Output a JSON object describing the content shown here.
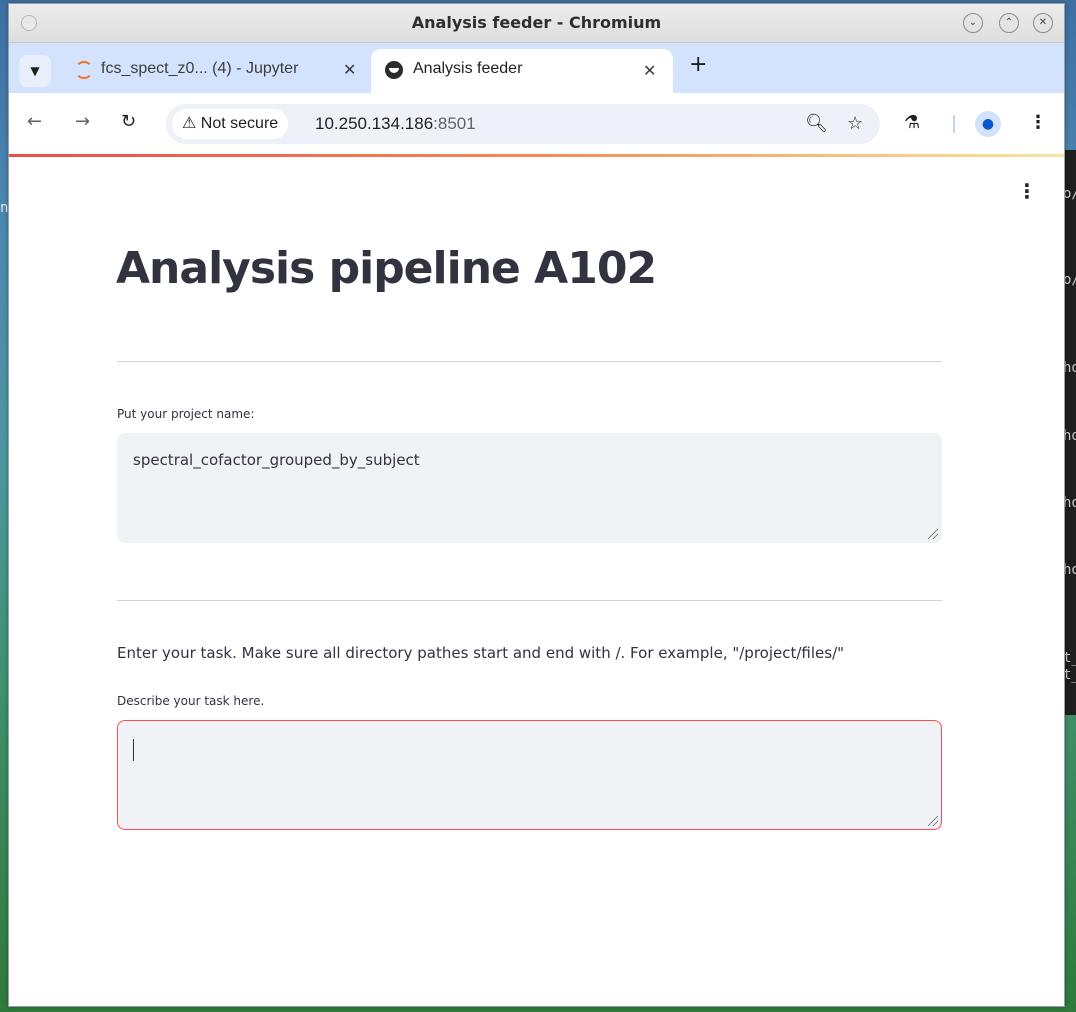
{
  "window": {
    "title": "Analysis feeder - Chromium"
  },
  "tabs": [
    {
      "label": "fcs_spect_z0... (4) - Jupyter",
      "active": false,
      "icon": "jupyter-icon"
    },
    {
      "label": "Analysis feeder",
      "active": true,
      "icon": "streamlit-icon"
    }
  ],
  "toolbar": {
    "security_chip": "Not secure",
    "url_host": "10.250.134.186",
    "url_port": ":8501"
  },
  "page": {
    "title": "Analysis pipeline A102",
    "project_label": "Put your project name:",
    "project_value": "spectral_cofactor_grouped_by_subject",
    "task_instruction": "Enter your task. Make sure all directory pathes start and end with /. For example, \"/project/files/\"",
    "task_label": "Describe your task here.",
    "task_value": ""
  },
  "colors": {
    "accent": "#ff4b4b",
    "text": "#31333f",
    "input_bg": "#f0f2f6",
    "tabstrip_bg": "#d3e3fd"
  }
}
